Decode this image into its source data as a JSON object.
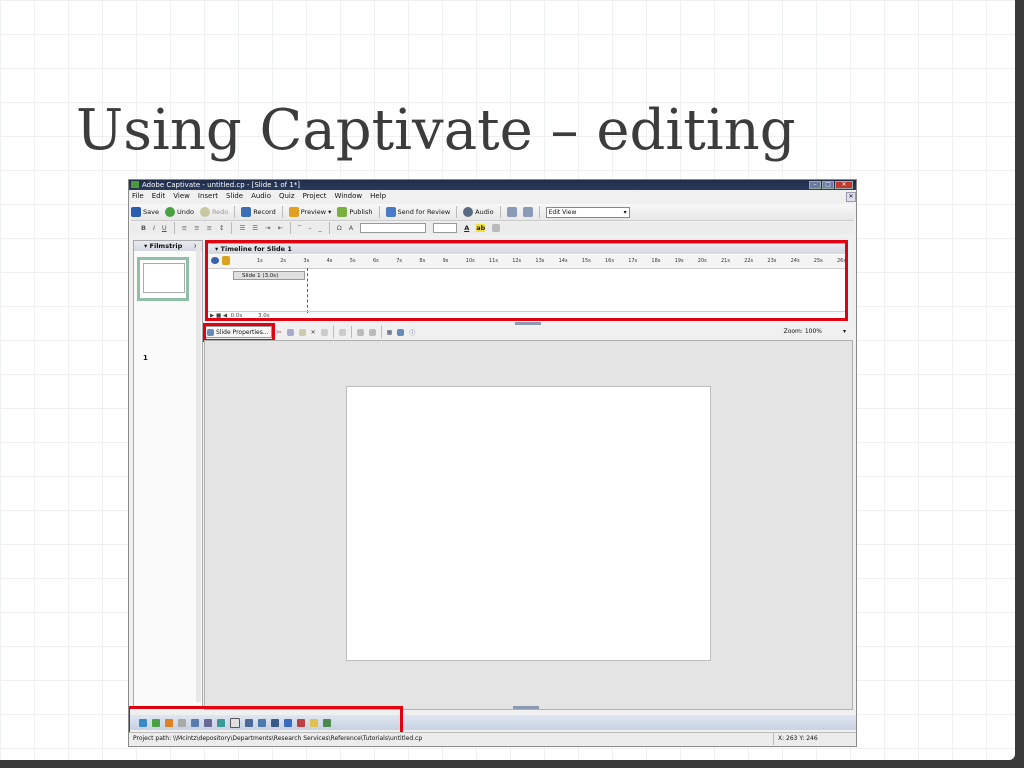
{
  "slide": {
    "title": "Using Captivate – editing"
  },
  "window": {
    "title": "Adobe Captivate - untitled.cp - [Slide 1 of 1*]"
  },
  "menu": [
    "File",
    "Edit",
    "View",
    "Insert",
    "Slide",
    "Audio",
    "Quiz",
    "Project",
    "Window",
    "Help"
  ],
  "toolbar": {
    "save": "Save",
    "undo": "Undo",
    "redo": "Redo",
    "record": "Record",
    "preview": "Preview",
    "publish": "Publish",
    "send_for_review": "Send for Review",
    "audio": "Audio",
    "view_select": "Edit View"
  },
  "filmstrip": {
    "title": "Filmstrip",
    "slide_number": "1"
  },
  "timeline": {
    "title": "Timeline for Slide 1",
    "ticks": [
      "1s",
      "2s",
      "3s",
      "4s",
      "5s",
      "6s",
      "7s",
      "8s",
      "9s",
      "10s",
      "11s",
      "12s",
      "13s",
      "14s",
      "15s",
      "16s",
      "17s",
      "18s",
      "19s",
      "20s",
      "21s",
      "22s",
      "23s",
      "24s",
      "25s",
      "26s"
    ],
    "track_label": "Slide 1 (3.0s)",
    "footer_start": "0.0s",
    "footer_end": "3.0s"
  },
  "stage": {
    "slide_properties": "Slide Properties...",
    "zoom": "Zoom: 100%"
  },
  "status": {
    "path": "Project path: \\\\Mcintz\\depository\\Departments\\Research Services\\Reference\\Tutorials\\untitled.cp",
    "coords": "X: 263 Y: 246"
  },
  "colors": {
    "highlight": "#e0000f",
    "title_bar": "#1f2d4a"
  }
}
